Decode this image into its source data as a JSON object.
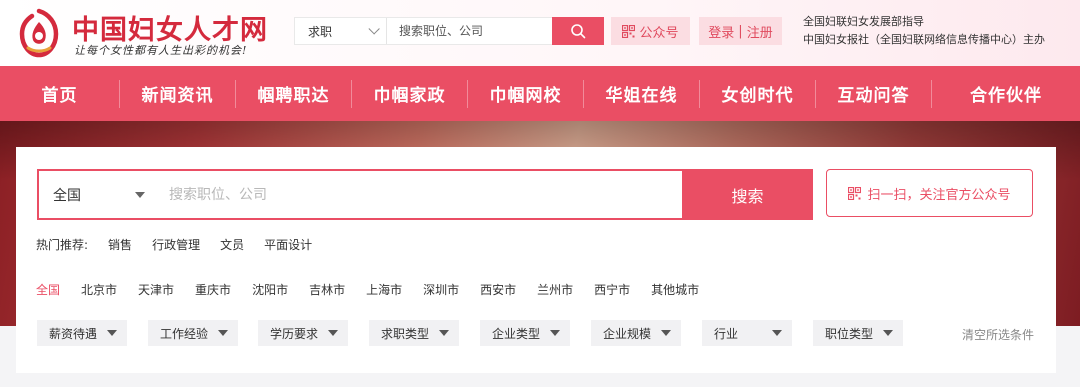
{
  "header": {
    "logo_title": "中国妇女人才网",
    "logo_slogan": "让每个女性都有人生出彩的机会!",
    "search_category": "求职",
    "search_placeholder": "搜索职位、公司",
    "gzh_label": "公众号",
    "login_label": "登录",
    "register_label": "注册",
    "login_separator": "|",
    "sponsor_line1": "全国妇联妇女发展部指导",
    "sponsor_line2": "中国妇女报社（全国妇联网络信息传播中心）主办"
  },
  "nav": {
    "items": [
      {
        "label": "首页"
      },
      {
        "label": "新闻资讯"
      },
      {
        "label": "帼聘职达"
      },
      {
        "label": "巾帼家政"
      },
      {
        "label": "巾帼网校"
      },
      {
        "label": "华姐在线"
      },
      {
        "label": "女创时代"
      },
      {
        "label": "互动问答"
      },
      {
        "label": "合作伙伴"
      }
    ]
  },
  "search_panel": {
    "region": "全国",
    "placeholder": "搜索职位、公司",
    "search_button": "搜索",
    "scan_text": "扫一扫，关注官方公众号",
    "hot_label": "热门推荐:",
    "hot_items": [
      "销售",
      "行政管理",
      "文员",
      "平面设计"
    ],
    "cities": [
      "全国",
      "北京市",
      "天津市",
      "重庆市",
      "沈阳市",
      "吉林市",
      "上海市",
      "深圳市",
      "西安市",
      "兰州市",
      "西宁市",
      "其他城市"
    ],
    "active_city": "全国",
    "filters": [
      "薪资待遇",
      "工作经验",
      "学历要求",
      "求职类型",
      "企业类型",
      "企业规模",
      "行业",
      "职位类型"
    ],
    "clear_label": "清空所选条件"
  },
  "colors": {
    "brand": "#ea4e64",
    "logo_red": "#d42a3d",
    "soft_pink": "#fbdde2"
  }
}
